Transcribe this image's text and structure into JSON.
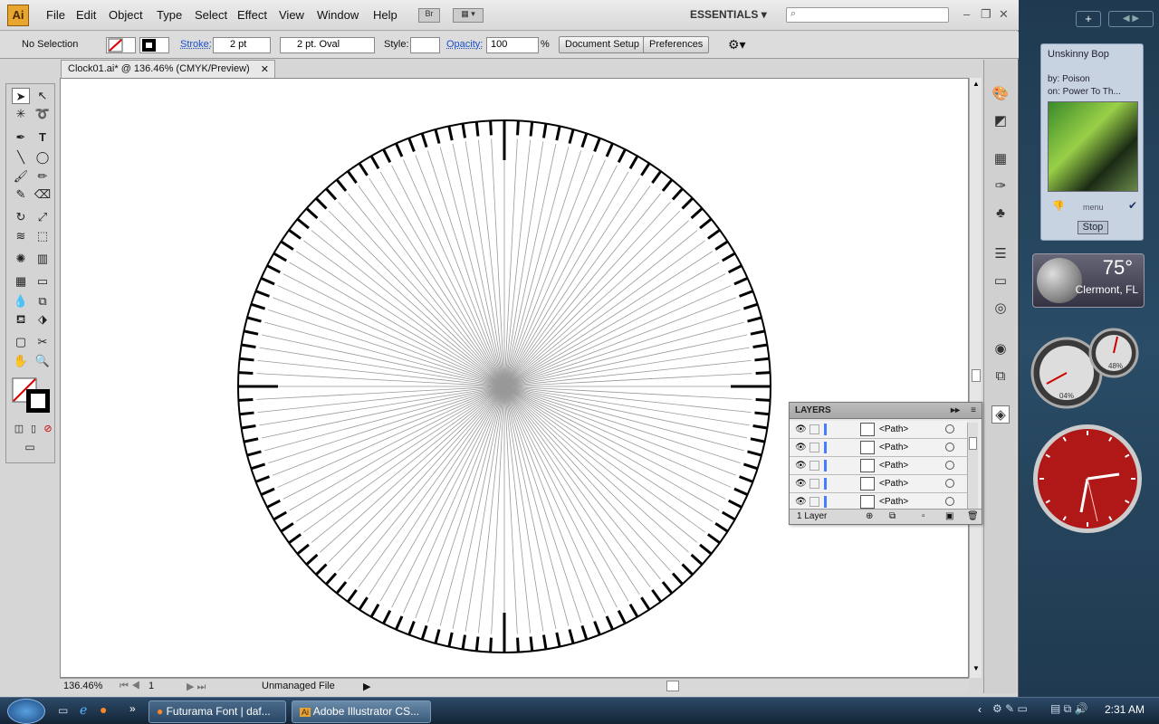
{
  "app": {
    "logo": "Ai",
    "menus": [
      "File",
      "Edit",
      "Object",
      "Type",
      "Select",
      "Effect",
      "View",
      "Window",
      "Help"
    ],
    "bridge_label": "Br",
    "workspace": "ESSENTIALS",
    "window_controls": [
      "–",
      "❐",
      "✕"
    ]
  },
  "control_bar": {
    "selection_status": "No Selection",
    "stroke_label": "Stroke:",
    "stroke_weight": "2 pt",
    "brush": "2 pt. Oval",
    "style_label": "Style:",
    "opacity_label": "Opacity:",
    "opacity_value": "100",
    "opacity_unit": "%",
    "document_setup": "Document Setup",
    "preferences": "Preferences"
  },
  "document": {
    "tab_title": "Clock01.ai* @ 136.46% (CMYK/Preview)",
    "tab_close": "✕"
  },
  "status": {
    "zoom": "136.46%",
    "artboard": "1",
    "profile": "Unmanaged File"
  },
  "layers_panel": {
    "title": "LAYERS",
    "rows": [
      {
        "name": "<Path>"
      },
      {
        "name": "<Path>"
      },
      {
        "name": "<Path>"
      },
      {
        "name": "<Path>"
      },
      {
        "name": "<Path>"
      }
    ],
    "footer": "1 Layer"
  },
  "gadgets": {
    "music": {
      "song": "Unskinny Bop",
      "artist": "by: Poison",
      "album": "on: Power To Th...",
      "menu": "menu",
      "stop": "Stop"
    },
    "weather": {
      "temp": "75°",
      "city": "Clermont, FL"
    },
    "meter": {
      "cpu": "04%",
      "mem": "48%"
    }
  },
  "taskbar": {
    "tasks": [
      "Futurama Font | daf...",
      "Adobe Illustrator CS..."
    ],
    "time": "2:31 AM"
  },
  "colors": {
    "accent_link": "#1a50c8",
    "ai_orange": "#e8a530",
    "clock_red": "#b01818"
  }
}
